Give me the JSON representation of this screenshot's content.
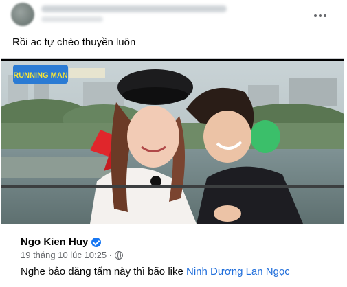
{
  "post": {
    "text": "Rồi ac tự chèo thuyền luôn",
    "more_icon": "more-horizontal-icon"
  },
  "photo": {
    "description_icon": "video-frame",
    "overlay_logo": "RUNNING MAN"
  },
  "shared": {
    "author": "Ngo Kien Huy",
    "time": "19 tháng 10 lúc 10:25 ·",
    "text": "Nghe bảo đăng tấm này thì bão like ",
    "mention": "Ninh Dương Lan Ngọc"
  },
  "colors": {
    "link": "#216fdb",
    "verified": "#1877f2",
    "muted": "#65676b"
  }
}
